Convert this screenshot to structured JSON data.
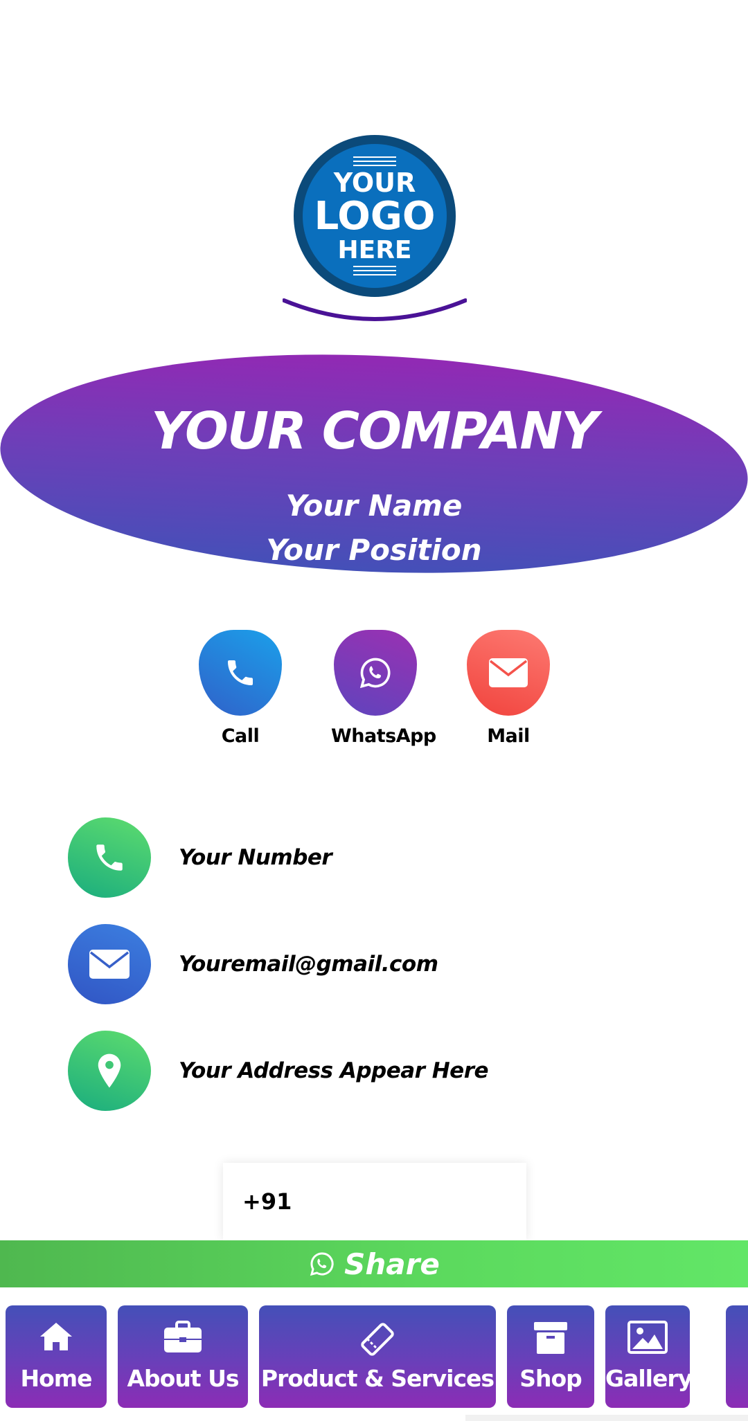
{
  "logo": {
    "line1": "YOUR",
    "line2": "LOGO",
    "line3": "HERE"
  },
  "header": {
    "company": "YOUR COMPANY",
    "name": "Your Name",
    "position": "Your Position"
  },
  "quick_actions": [
    {
      "label": "Call",
      "icon": "phone-icon",
      "color": "#1ba0ea"
    },
    {
      "label": "WhatsApp",
      "icon": "whatsapp-icon",
      "color": "#7a3bb8"
    },
    {
      "label": "Mail",
      "icon": "mail-icon",
      "color": "#f4524b"
    }
  ],
  "contacts": {
    "number": "Your Number",
    "email": "Youremail@gmail.com",
    "address": "Your Address Appear Here"
  },
  "share": {
    "phone_value": "+91",
    "button_label": "Share"
  },
  "nav": [
    {
      "label": "Home",
      "icon": "home-icon"
    },
    {
      "label": "About Us",
      "icon": "briefcase-icon"
    },
    {
      "label": "Product & Services",
      "icon": "tag-icon"
    },
    {
      "label": "Shop",
      "icon": "box-icon"
    },
    {
      "label": "Gallery",
      "icon": "image-icon"
    }
  ],
  "colors": {
    "header_top": "#9229b4",
    "header_bottom": "#4450b8",
    "share_green": "#5cda5e",
    "logo_blue": "#0a6fbd"
  }
}
